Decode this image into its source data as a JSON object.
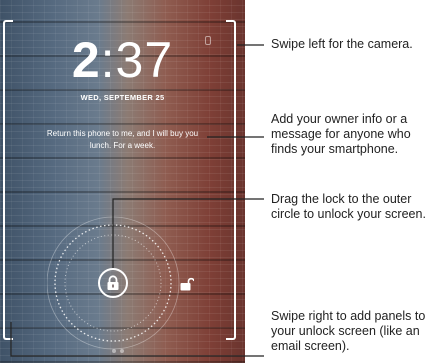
{
  "lockscreen": {
    "time_hour": "2",
    "time_sep": ":",
    "time_minutes": "37",
    "date": "WED, SEPTEMBER 25",
    "owner_message": "Return this phone to me, and I will buy you lunch. For a week."
  },
  "callouts": {
    "camera": "Swipe left for the camera.",
    "owner_info": "Add your owner info or a message for anyone who finds your smartphone.",
    "lock": "Drag the lock to the outer circle to unlock your screen.",
    "panels": "Swipe right to add panels to your unlock screen (like an email screen)."
  },
  "icons": [
    "lock-icon",
    "unlock-icon",
    "camera-hint-icon"
  ],
  "colors": {
    "wall_blue": "#566a80",
    "wall_red": "#8f5c50",
    "overlay": "#ffffff",
    "callout_text": "#222222"
  }
}
